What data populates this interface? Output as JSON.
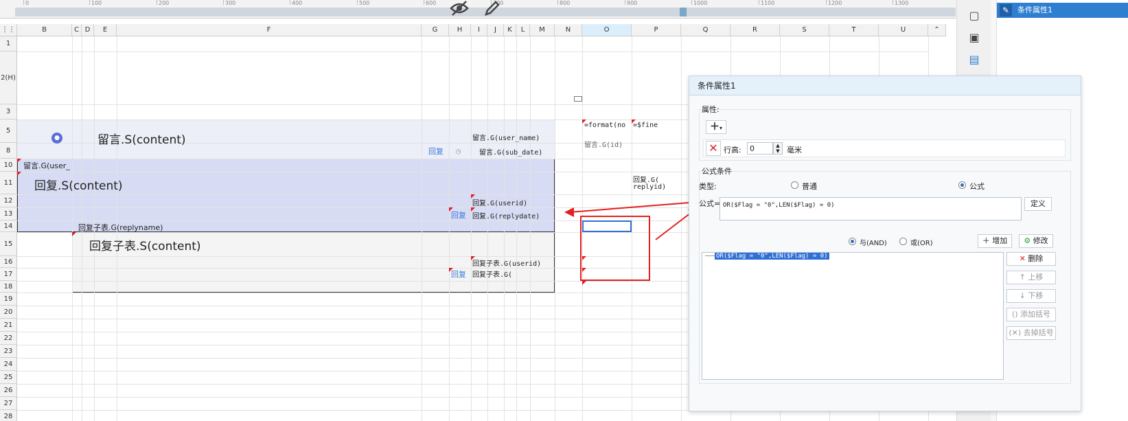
{
  "toolbar": {
    "ruler_labels": [
      "0",
      "100",
      "200",
      "300",
      "400",
      "500",
      "600",
      "700",
      "800",
      "900",
      "1000",
      "1100",
      "1200",
      "1300"
    ],
    "hide_icon": "eye-slash-icon",
    "edit_icon": "pencil-icon"
  },
  "sheet": {
    "corner_label": "",
    "columns": [
      "B",
      "C",
      "D",
      "E",
      "F",
      "G",
      "H",
      "I",
      "J",
      "K",
      "L",
      "M",
      "N",
      "O",
      "P",
      "Q",
      "R",
      "S",
      "T",
      "U"
    ],
    "selected_column": "O",
    "rows": [
      "1",
      "2(H)",
      "3",
      "5",
      "8",
      "10",
      "11",
      "12",
      "13",
      "14",
      "15",
      "16",
      "17",
      "18",
      "19",
      "20",
      "21",
      "22",
      "23",
      "24",
      "25",
      "26",
      "27",
      "28"
    ],
    "cells": {
      "r5_main": "留言.S(content)",
      "r5_user": "留言.G(user_name)",
      "r5_format": "=format(no",
      "r5_fine": "=$fine",
      "r8_reply_link": "回复",
      "r8_subdate": "留言.G(sub_date)",
      "r8_o": "留言.G(id)",
      "r10_user": "留言.G(user_",
      "r11_main": "回复.S(content)",
      "r11_p": "回复.G(",
      "r11_p2": "replyid)",
      "r12_userid": "回复.G(userid)",
      "r13_reply_link": "回复",
      "r13_replydate": "回复.G(replydate)",
      "r14_replyname": "回复子表.G(replyname)",
      "r15_main": "回复子表.S(content)",
      "r16_userid": "回复子表.G(userid)",
      "r17_reply_link": "回复",
      "r17_g": "回复子表.G("
    }
  },
  "right_toolbar": {
    "icons": [
      "square-icon",
      "dropdown-box-icon",
      "layout-icon"
    ]
  },
  "tree": {
    "item_label": "条件属性1",
    "item_icon": "pencil-icon"
  },
  "dialog": {
    "title": "条件属性1",
    "attr_section": "属性:",
    "add_attr_icon": "plus-icon",
    "row_height_label": "行高:",
    "row_height_value": "0",
    "row_height_unit": "毫米",
    "formula_section": "公式条件",
    "type_label": "类型:",
    "type_normal": "普通",
    "type_formula": "公式",
    "formula_label": "公式=",
    "formula_value": "OR($Flag = \"0\",LEN($Flag) = 0)",
    "define_button": "定义",
    "and_label": "与(AND)",
    "or_label": "或(OR)",
    "add_button": "增加",
    "modify_button": "修改",
    "condition_item": "OR($Flag = \"0\",LEN($Flag) = 0)",
    "delete_button": "删除",
    "up_button": "上移",
    "down_button": "下移",
    "add_bracket_button": "添加括号",
    "remove_bracket_button": "去掉括号"
  },
  "colors": {
    "accent": "#2f7fd1",
    "band_blue": "#dfe4f7",
    "highlight_red": "#e41f1f",
    "link_blue": "#3a7bd5"
  }
}
